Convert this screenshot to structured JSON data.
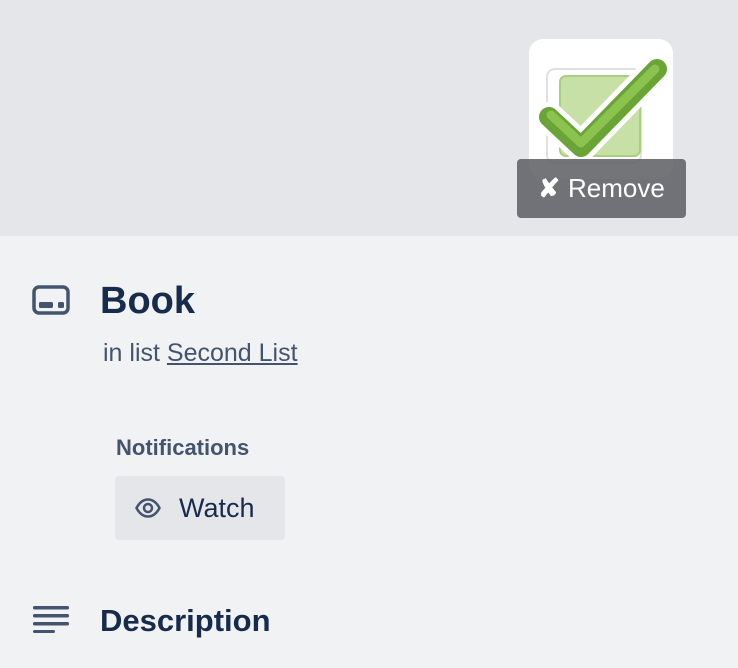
{
  "cover": {
    "sticker_icon": "check-mark-sticker",
    "remove_label": "Remove",
    "remove_icon": "✘"
  },
  "card": {
    "icon": "card-icon",
    "title": "Book",
    "list_prefix": "in list",
    "list_name": "Second List"
  },
  "notifications": {
    "label": "Notifications",
    "watch_label": "Watch",
    "watch_icon": "eye-icon"
  },
  "description": {
    "icon": "description-lines-icon",
    "title": "Description"
  },
  "colors": {
    "cover_bg": "#e4e6ea",
    "page_bg": "#f1f2f4",
    "title_text": "#172b4d",
    "sticker_green": "#7ab648"
  }
}
